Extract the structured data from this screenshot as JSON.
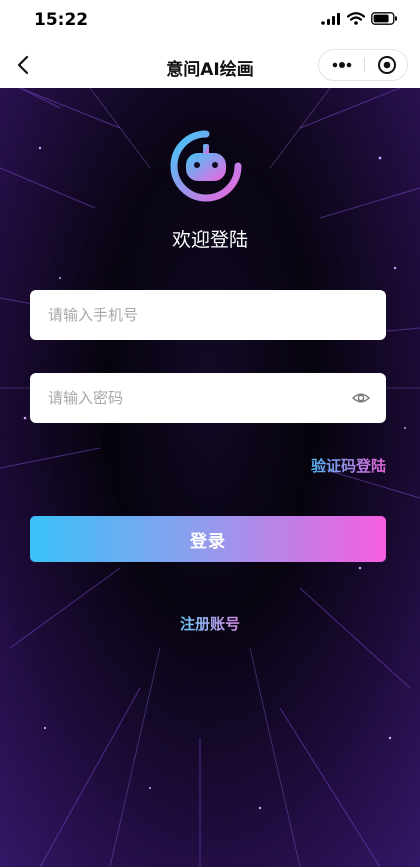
{
  "status_bar": {
    "time": "15:22"
  },
  "nav": {
    "title": "意间AI绘画"
  },
  "login": {
    "welcome": "欢迎登陆",
    "phone_placeholder": "请输入手机号",
    "password_placeholder": "请输入密码",
    "sms_login_label": "验证码登陆",
    "login_button": "登录",
    "register_label": "注册账号"
  },
  "colors": {
    "gradient_start": "#39c1f7",
    "gradient_end": "#f65ee0",
    "background": "#07040d"
  },
  "icons": [
    "signal-icon",
    "wifi-icon",
    "battery-icon",
    "back-arrow-icon",
    "more-dots-icon",
    "close-circle-icon",
    "robot-logo-icon",
    "eye-icon"
  ]
}
